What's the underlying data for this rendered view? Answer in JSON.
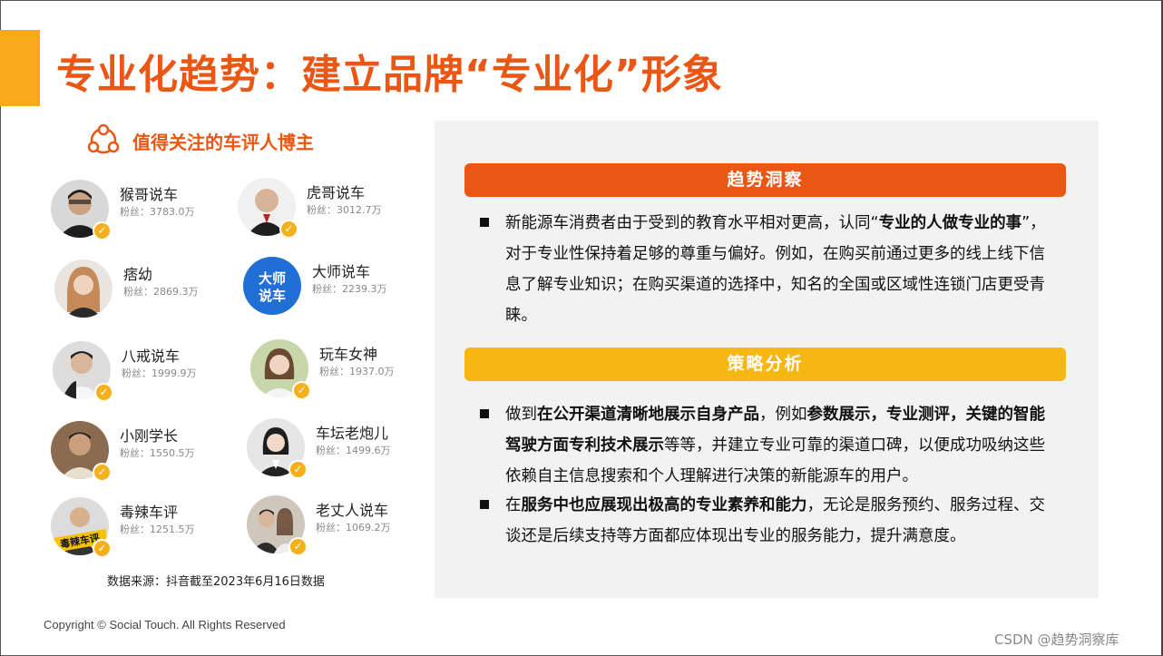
{
  "title": "专业化趋势：建立品牌“专业化”形象",
  "left": {
    "heading": "值得关注的车评人博主",
    "bloggers": [
      {
        "name": "猴哥说车",
        "fans": "粉丝：3783.0万"
      },
      {
        "name": "虎哥说车",
        "fans": "粉丝：3012.7万"
      },
      {
        "name": "痞幼",
        "fans": "粉丝：2869.3万"
      },
      {
        "name": "大师说车",
        "fans": "粉丝：2239.3万",
        "logo_text": "大师说车"
      },
      {
        "name": "八戒说车",
        "fans": "粉丝：1999.9万"
      },
      {
        "name": "玩车女神",
        "fans": "粉丝：1937.0万"
      },
      {
        "name": "小刚学长",
        "fans": "粉丝：1550.5万"
      },
      {
        "name": "车坛老炮儿",
        "fans": "粉丝：1499.6万"
      },
      {
        "name": "毒辣车评",
        "fans": "粉丝：1251.5万",
        "logo_text": "毒辣车评"
      },
      {
        "name": "老丈人说车",
        "fans": "粉丝：1069.2万"
      }
    ],
    "source": "数据来源：抖音截至2023年6月16日数据"
  },
  "right": {
    "section1": {
      "label": "趋势洞察",
      "p1_a": "新能源车消费者由于受到的教育水平相对更高，认同“",
      "p1_b": "专业的人做专业的事",
      "p1_c": "”，对于专业性保持着足够的尊重与偏好。例如，在购买前通过更多的线上线下信息了解专业知识；在购买渠道的选择中，知名的全国或区域性连锁门店更受青睐。"
    },
    "section2": {
      "label": "策略分析",
      "p2_a": "做到",
      "p2_b": "在公开渠道清晰地展示自身产品",
      "p2_c": "，例如",
      "p2_d": "参数展示，专业测评，关键的智能驾驶方面专利技术展示",
      "p2_e": "等等，并建立专业可靠的渠道口碑，以便成功吸纳这些依赖自主信息搜索和个人理解进行决策的新能源车的用户。",
      "p3_a": "在",
      "p3_b": "服务中也应展现出极高的专业素养和能力",
      "p3_c": "，无论是服务预约、服务过程、交谈还是后续支持等方面都应体现出专业的服务能力，提升满意度。"
    }
  },
  "footer": {
    "copyright": "Copyright © Social Touch. All Rights Reserved",
    "watermark": "CSDN @趋势洞察库"
  },
  "colors": {
    "accent_orange": "#ea5613",
    "accent_yellow": "#f7b712",
    "title_bar": "#f7a81b",
    "check": "#f5b01c"
  }
}
